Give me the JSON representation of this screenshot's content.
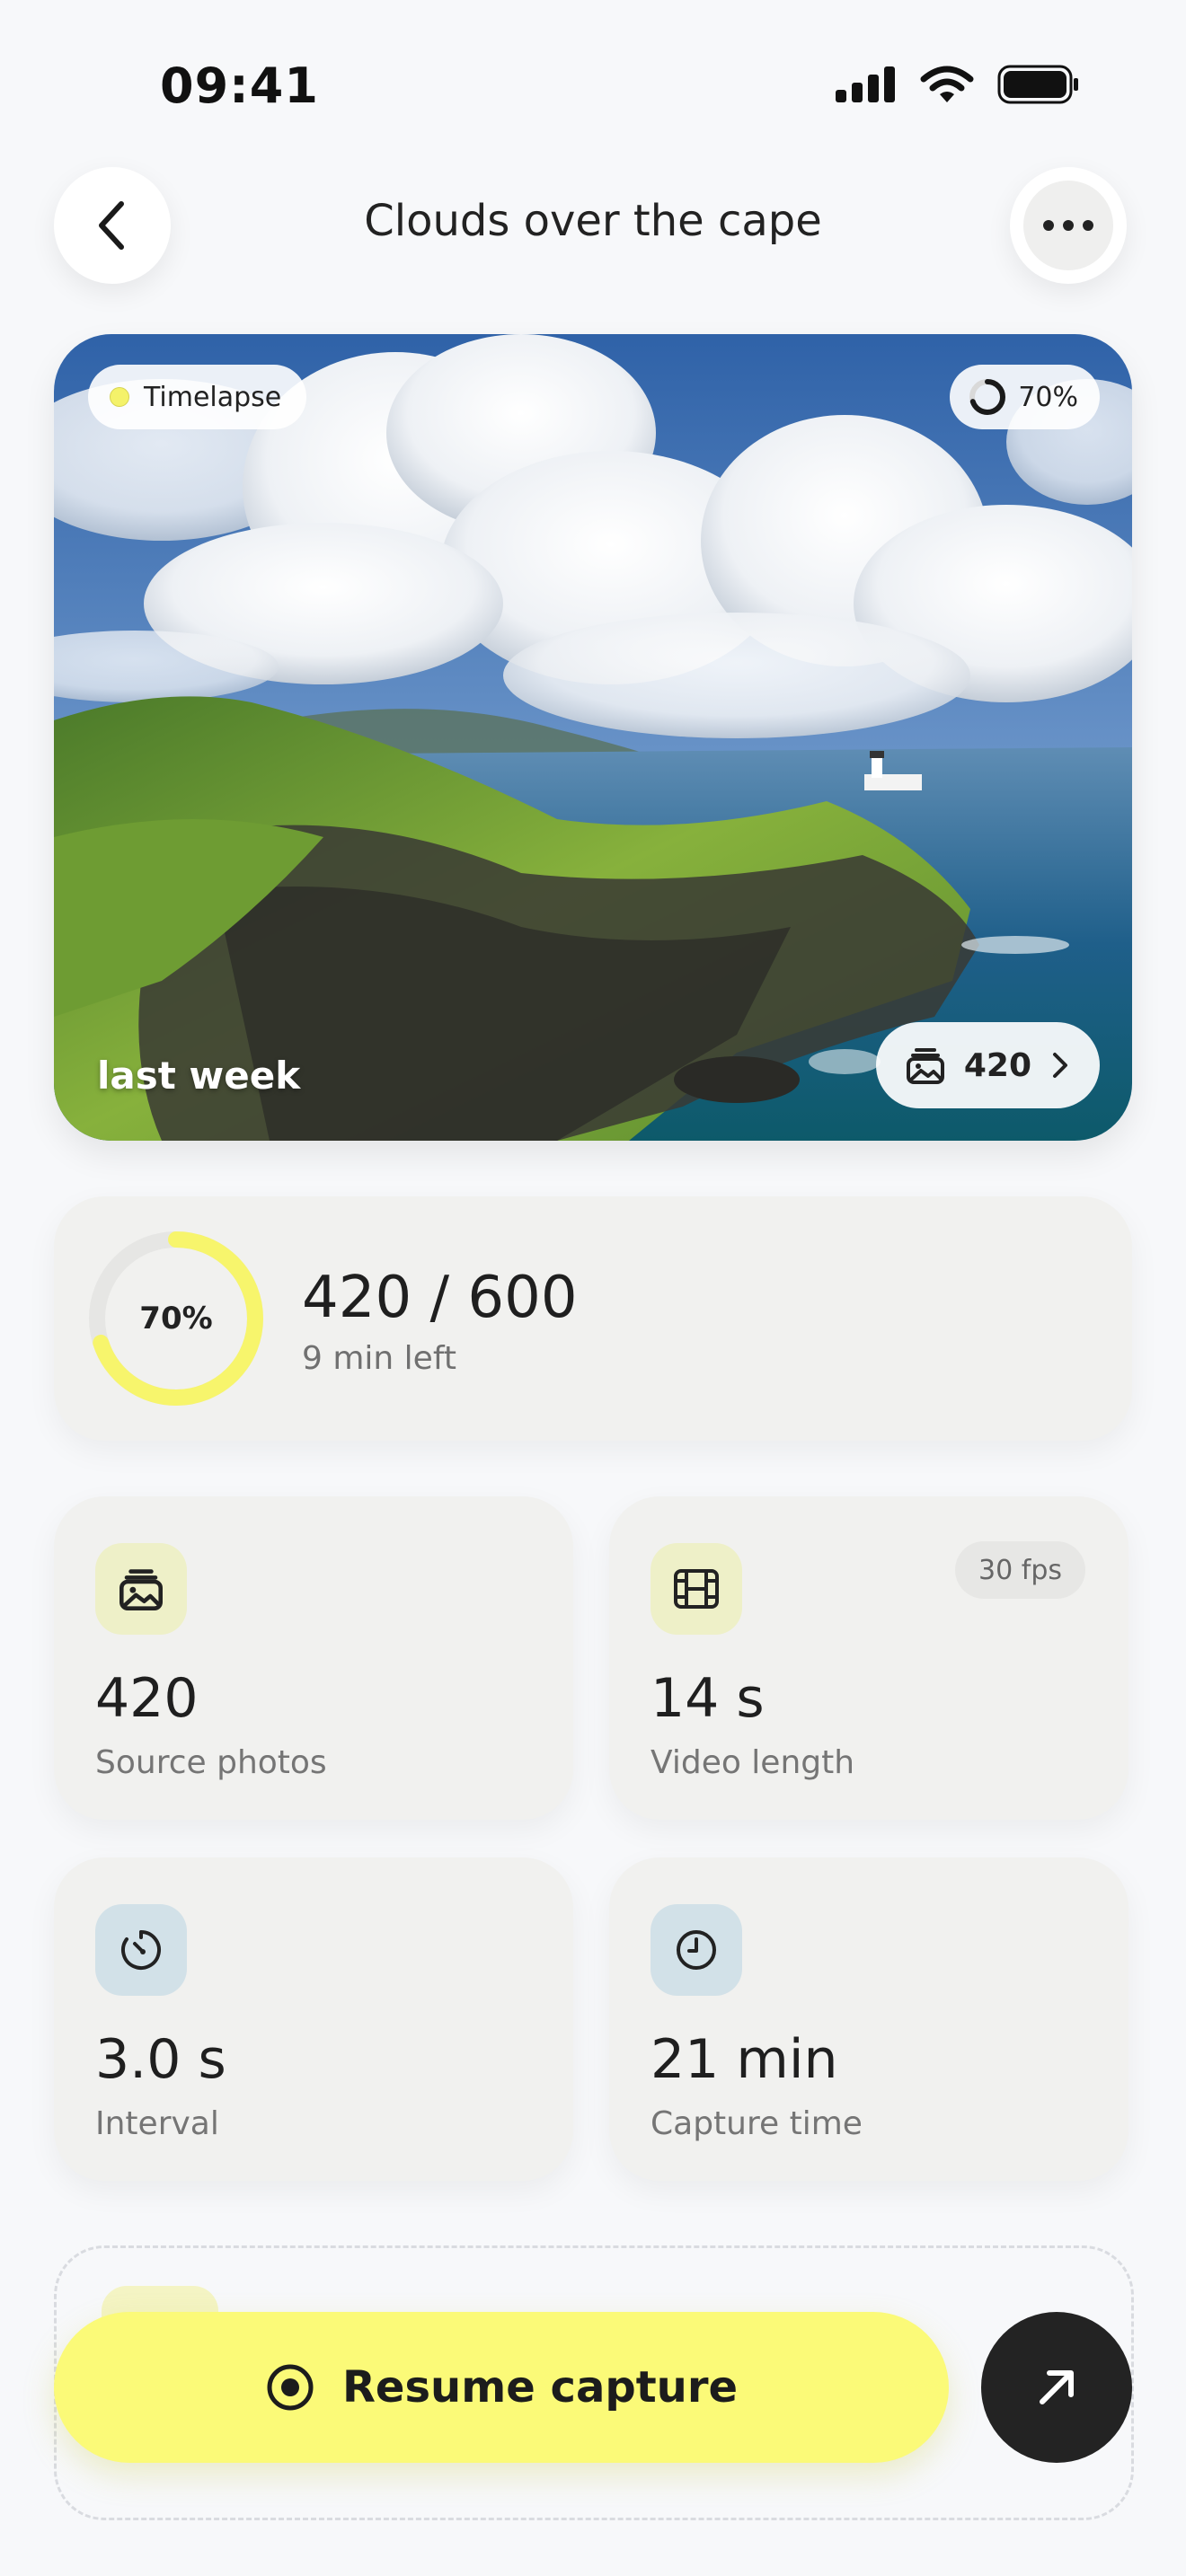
{
  "status_bar": {
    "time": "09:41"
  },
  "header": {
    "title": "Clouds over the cape"
  },
  "hero": {
    "type_label": "Timelapse",
    "progress_label": "70%",
    "progress": 0.7,
    "date_label": "last week",
    "photo_count": "420"
  },
  "progress_card": {
    "percent_label": "70%",
    "progress": 0.7,
    "captured": "420 / 600",
    "time_left": "9 min left"
  },
  "stats": [
    {
      "value": "420",
      "label": "Source photos",
      "icon": "photos-icon"
    },
    {
      "value": "14 s",
      "label": "Video length",
      "icon": "film-icon",
      "badge": "30 fps"
    },
    {
      "value": "3.0 s",
      "label": "Interval",
      "icon": "timer-icon"
    },
    {
      "value": "21 min",
      "label": "Capture time",
      "icon": "clock-icon"
    }
  ],
  "cta": {
    "label": "Resume capture"
  },
  "colors": {
    "accent": "#fbfa78",
    "ring": "#f7f56c",
    "dark": "#232323"
  }
}
